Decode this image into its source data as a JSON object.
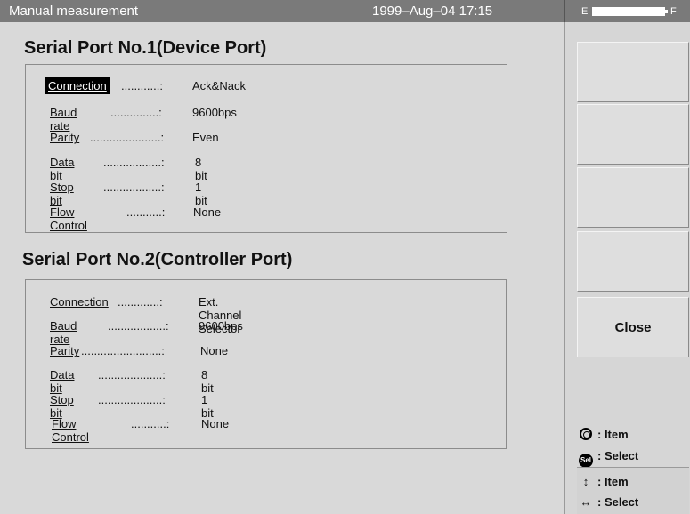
{
  "title_bar": {
    "title": "Manual measurement",
    "datetime": "1999–Aug–04 17:15",
    "battery_empty_label": "E",
    "battery_full_label": "F"
  },
  "port1": {
    "title": "Serial Port No.1(Device Port)",
    "rows": [
      {
        "label": "Connection",
        "dots": "............:",
        "value": "Ack&Nack"
      },
      {
        "label": "Baud rate",
        "dots": "...............:",
        "value": "9600bps"
      },
      {
        "label": "Parity",
        "dots": "......................:",
        "value": "Even"
      },
      {
        "label": "Data bit",
        "dots": "..................:",
        "value": "8 bit"
      },
      {
        "label": "Stop bit",
        "dots": "..................:",
        "value": "1 bit"
      },
      {
        "label": "Flow Control",
        "dots": "...........:",
        "value": "None"
      }
    ]
  },
  "port2": {
    "title": "Serial Port No.2(Controller Port)",
    "rows": [
      {
        "label": "Connection",
        "dots": ".............:",
        "value": "Ext. Channel Selector"
      },
      {
        "label": "Baud rate",
        "dots": "..................:",
        "value": "9600bps"
      },
      {
        "label": "Parity",
        "dots": ".........................:",
        "value": "None"
      },
      {
        "label": "Data bit",
        "dots": "....................:",
        "value": "8 bit"
      },
      {
        "label": "Stop bit",
        "dots": "....................:",
        "value": "1 bit"
      },
      {
        "label": "Flow Control",
        "dots": "...........:",
        "value": "None"
      }
    ]
  },
  "softkeys": {
    "close_label": "Close"
  },
  "legend": {
    "dial_item": ": Item",
    "sel_button_text": "Sel",
    "sel_select": ": Select",
    "updown_item": ": Item",
    "leftright_select": ": Select"
  }
}
